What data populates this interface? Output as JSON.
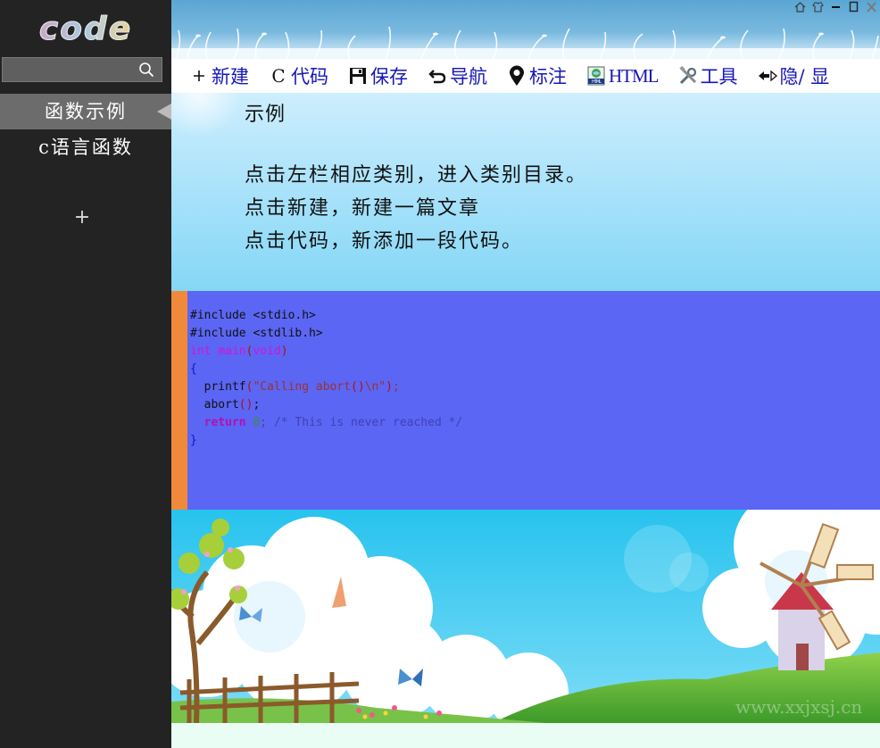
{
  "app": {
    "logo_text": "code"
  },
  "sidebar": {
    "search": {
      "placeholder": "",
      "value": ""
    },
    "items": [
      {
        "label": "函数示例",
        "active": true
      },
      {
        "label": "c语言函数",
        "active": false
      }
    ],
    "add_label": "+"
  },
  "toolbar": {
    "new_label": "新建",
    "code_label": "代码",
    "save_label": "保存",
    "nav_label": "导航",
    "mark_label": "标注",
    "html_label": "HTML",
    "tools_label": "工具",
    "toggle_label": "隐/ 显"
  },
  "content": {
    "title": "示例",
    "lines": [
      "点击左栏相应类别，进入类别目录。",
      "点击新建，新建一篇文章",
      "点击代码，新添加一段代码。"
    ]
  },
  "code": {
    "line1": "#include <stdio.h>",
    "line2": "#include <stdlib.h>",
    "kw_int": "int",
    "fn_main": "main",
    "kw_void": "void",
    "fn_printf": "printf",
    "str_calling": "\"Calling abort",
    "str_end": "\\n\"",
    "fn_abort": "abort",
    "kw_return": "return",
    "num_zero": "0",
    "comment": "/* This is never reached */"
  },
  "scene": {
    "watermark": "www.xxjxsj.cn"
  },
  "colors": {
    "sidebar_bg": "#232323",
    "toolbar_text": "#1616b8",
    "code_bg": "#5b66f4",
    "code_accent": "#f08a3a"
  },
  "icons": [
    "search-icon",
    "home-icon",
    "skin-icon",
    "minimize-icon",
    "maximize-icon",
    "close-icon",
    "save-icon",
    "undo-icon",
    "location-pin-icon",
    "html-file-icon",
    "tools-icon",
    "swap-icon"
  ]
}
